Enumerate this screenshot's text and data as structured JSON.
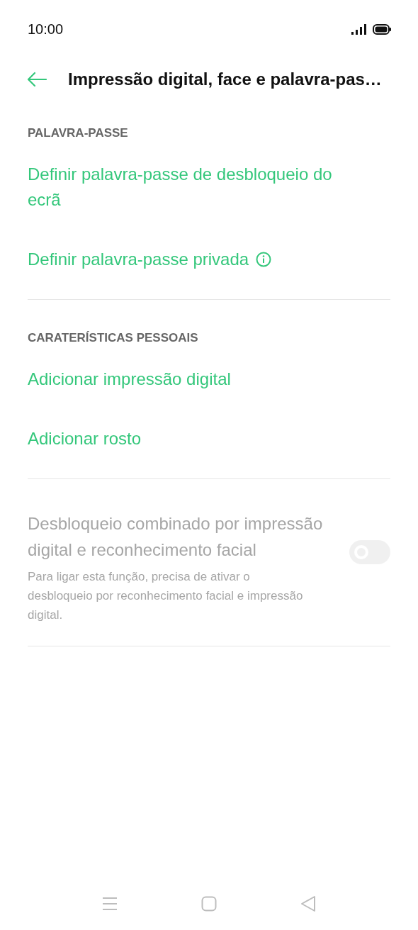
{
  "status_bar": {
    "time": "10:00"
  },
  "header": {
    "title": "Impressão digital, face e palavra-pas…"
  },
  "sections": [
    {
      "title": "PALAVRA-PASSE",
      "items": [
        {
          "kind": "link",
          "label": "Definir palavra-passe de desbloqueio do ecrã",
          "info": false
        },
        {
          "kind": "link",
          "label": "Definir palavra-passe privada",
          "info": true
        }
      ]
    },
    {
      "title": "CARATERÍSTICAS PESSOAIS",
      "items": [
        {
          "kind": "link",
          "label": "Adicionar impressão digital",
          "info": false
        },
        {
          "kind": "link",
          "label": "Adicionar rosto",
          "info": false
        }
      ]
    },
    {
      "items": [
        {
          "kind": "toggle",
          "label": "Desbloqueio combinado por impressão digital e reconhecimento facial",
          "description": "Para ligar esta função, precisa de ativar o desbloqueio por reconhecimento facial e impressão digital.",
          "on": false,
          "disabled": true
        }
      ]
    }
  ]
}
